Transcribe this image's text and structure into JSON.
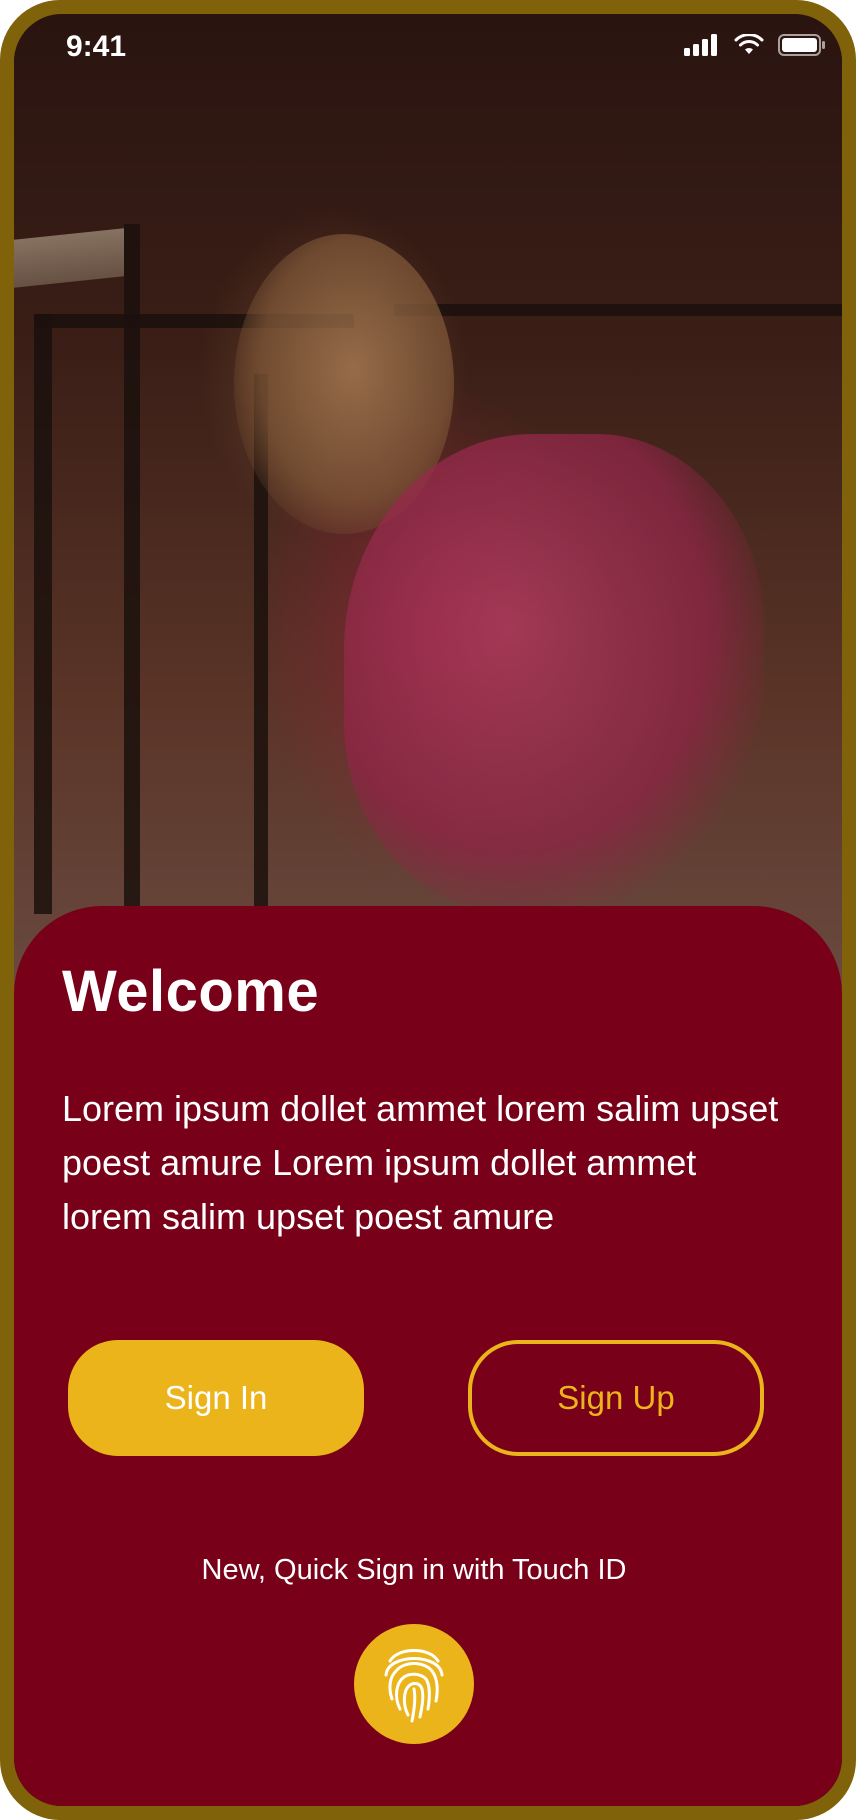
{
  "status_bar": {
    "time": "9:41",
    "icons": [
      "cellular-signal-icon",
      "wifi-icon",
      "battery-icon"
    ]
  },
  "hero": {
    "image": "athlete-photo"
  },
  "welcome": {
    "title": "Welcome",
    "body": "Lorem ipsum dollet ammet lorem salim upset poest amure Lorem ipsum dollet ammet lorem salim upset poest amure"
  },
  "buttons": {
    "sign_in": "Sign In",
    "sign_up": "Sign Up"
  },
  "touch_id": {
    "label": "New, Quick Sign in with Touch ID",
    "icon": "fingerprint-icon"
  },
  "colors": {
    "frame": "#7f6209",
    "card": "#780019",
    "accent": "#ecb41b",
    "text": "#ffffff"
  }
}
